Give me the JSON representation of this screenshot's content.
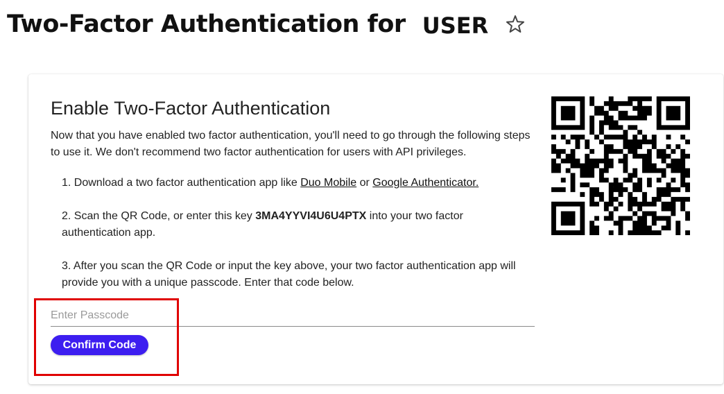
{
  "header": {
    "title": "Two-Factor Authentication for",
    "user": "USER",
    "favorite_icon": "star-icon"
  },
  "card": {
    "heading": "Enable Two-Factor Authentication",
    "intro": "Now that you have enabled two factor authentication, you'll need to go through the following steps to use it. We don't recommend two factor authentication for users with API privileges.",
    "step1": {
      "prefix": "1. Download a two factor authentication app like ",
      "link1": "Duo Mobile",
      "middle": " or ",
      "link2": "Google Authenticator."
    },
    "step2": {
      "prefix": "2. Scan the QR Code, or enter this key ",
      "key": "3MA4YYVI4U6U4PTX",
      "suffix": " into your two factor authentication app."
    },
    "step3": "3. After you scan the QR Code or input the key above, your two factor authentication app will provide you with a unique passcode. Enter that code below.",
    "passcode": {
      "value": "",
      "placeholder": "Enter Passcode"
    },
    "confirm_label": "Confirm Code",
    "qr_icon": "qr-code"
  },
  "colors": {
    "accent": "#3d1ef0",
    "highlight": "#e00000"
  }
}
